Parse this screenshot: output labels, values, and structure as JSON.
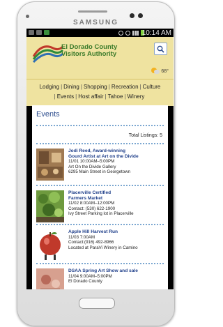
{
  "device": {
    "brand": "SAMSUNG"
  },
  "statusbar": {
    "time": "10:14 AM"
  },
  "header": {
    "logo_line1": "El Dorado County",
    "logo_line2": "Visitors Authority",
    "weather_temp": "68°",
    "weather_icon": "partly-sunny-icon",
    "search_icon": "search-icon"
  },
  "nav": {
    "row1": [
      "Lodging",
      "Dining",
      "Shopping",
      "Recreation",
      "Culture"
    ],
    "row2": [
      "Events",
      "Host affair",
      "Tahoe",
      "Winery"
    ]
  },
  "page": {
    "title": "Events",
    "total_listings": "Total Listings: 5"
  },
  "listings": [
    {
      "title_line1": "Jodi Reed, Award-winning",
      "title_line2": "Gourd Artist at Art on the Divide",
      "line1": "11/01 10:00AM–5:00PM",
      "line2": "Art On the Divide Gallery",
      "line3": "6295 Main Street in Georgetown",
      "thumb_color": "#8b6a4a"
    },
    {
      "title_line1": "Placerville Certified",
      "title_line2": "Farmers Market",
      "line1": "11/02 8:00AM–12:00PM",
      "line2": "Contact: (530) 622-1900",
      "line3": "Ivy Street Parking lot in Placerville",
      "thumb_color": "#5e8b3a"
    },
    {
      "title_line1": "Apple Hill Harvest Run",
      "title_line2": "",
      "line1": "11/03 7:00AM",
      "line2": "Contact:(916) 492-8966",
      "line3": "Located at ParaVi Winery in Camino",
      "thumb_color": "#c0392b"
    },
    {
      "title_line1": "DSAA Spring Art Show and sale",
      "title_line2": "",
      "line1": "11/04 9:00AM–5:00PM",
      "line2": "El Dorado County",
      "line3": "",
      "thumb_color": "#c98a7a"
    }
  ],
  "colors": {
    "header_bg": "#efe3a0",
    "title_blue": "#2f4f8f",
    "link_blue": "#1f3f8a",
    "divider": "#7aa6d0"
  }
}
